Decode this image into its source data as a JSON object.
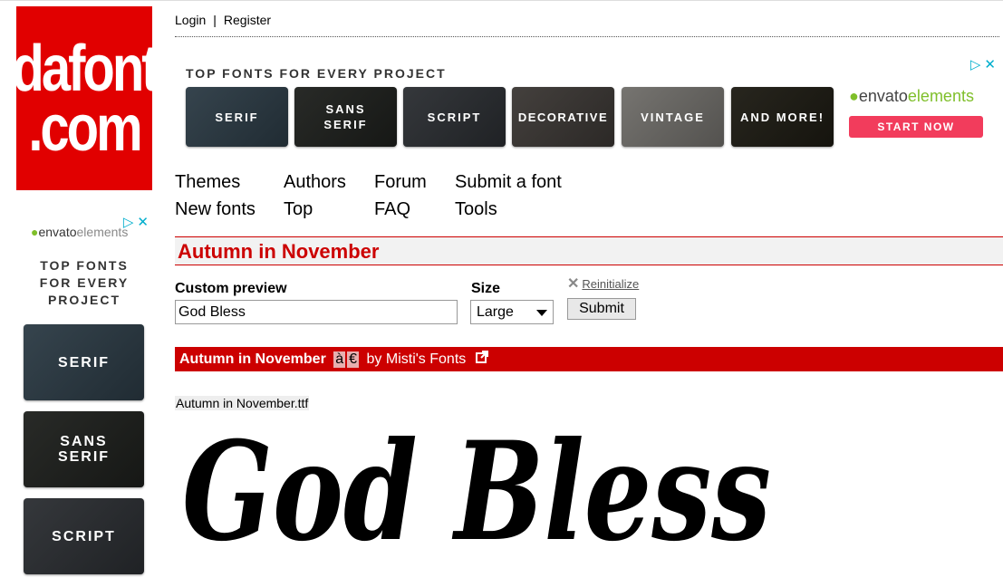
{
  "logo": {
    "line1": "dafont",
    "line2": ".com",
    "color": "#e10000"
  },
  "header": {
    "login": "Login",
    "separator": "|",
    "register": "Register"
  },
  "ads": {
    "title": "TOP FONTS FOR EVERY PROJECT",
    "side_title_lines": [
      "TOP FONTS",
      "FOR EVERY",
      "PROJECT"
    ],
    "brand_prefix": "envato",
    "brand_suffix": "elements",
    "cta": "START NOW",
    "cta_color": "#f23c5c",
    "thumbnails": [
      {
        "label": "SERIF",
        "bg": "#2b3a44"
      },
      {
        "label": "SANS SERIF",
        "bg": "#1d1f1c"
      },
      {
        "label": "SCRIPT",
        "bg": "#2a2d31"
      },
      {
        "label": "DECORATIVE",
        "bg": "#3a3633"
      },
      {
        "label": "VINTAGE",
        "bg": "#6f6d69"
      },
      {
        "label": "AND MORE!",
        "bg": "#1c1a12"
      }
    ],
    "icons": [
      "adchoices-icon",
      "close-icon"
    ]
  },
  "nav": {
    "col1": [
      "Themes",
      "New fonts"
    ],
    "col2": [
      "Authors",
      "Top"
    ],
    "col3": [
      "Forum",
      "FAQ"
    ],
    "col4": [
      "Submit a font",
      "Tools"
    ]
  },
  "page_title": "Autumn in November",
  "form": {
    "custom_preview_label": "Custom preview",
    "custom_preview_value": "God Bless",
    "size_label": "Size",
    "size_value": "Large",
    "reinit_label": "Reinitialize",
    "submit_label": "Submit"
  },
  "font": {
    "name": "Autumn in November",
    "glyph1": "à",
    "glyph2": "€",
    "by": "by Misti's Fonts",
    "filename": "Autumn in November.ttf",
    "preview_text": "God Bless"
  },
  "colors": {
    "accent": "#cc0000",
    "envato_green": "#7fbf2a"
  }
}
